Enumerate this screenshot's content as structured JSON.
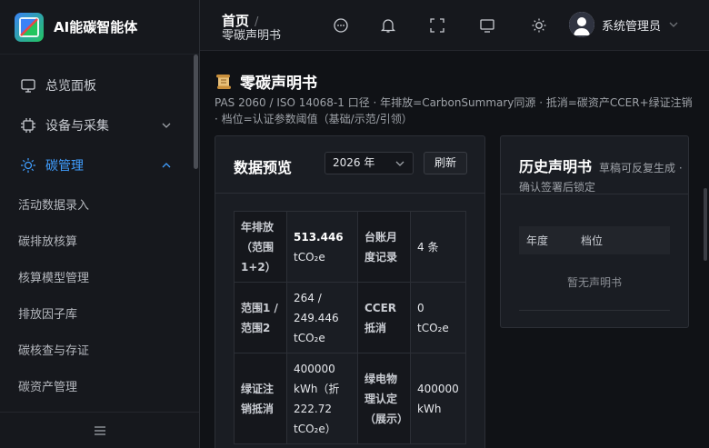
{
  "app": {
    "name": "AI能碳智能体"
  },
  "sidebar": {
    "menu": [
      {
        "label": "总览面板",
        "icon": "monitor-icon"
      },
      {
        "label": "设备与采集",
        "icon": "chip-icon"
      },
      {
        "label": "碳管理",
        "icon": "sun-icon"
      }
    ],
    "submenu": [
      "活动数据录入",
      "碳排放核算",
      "核算模型管理",
      "排放因子库",
      "碳核查与存证",
      "碳资产管理"
    ]
  },
  "header": {
    "breadcrumb_home": "首页",
    "breadcrumb_sep": "/",
    "breadcrumb_current": "零碳声明书",
    "user_name": "系统管理员"
  },
  "page": {
    "title": "零碳声明书",
    "title_icon": "scroll-icon",
    "description": "PAS 2060 / ISO 14068-1 口径 · 年排放=CarbonSummary同源 · 抵消=碳资产CCER+绿证注销 · 档位=认证参数阈值（基础/示范/引领）"
  },
  "preview": {
    "title": "数据预览",
    "year": "2026 年",
    "refresh_label": "刷新",
    "rows": [
      {
        "k1": "年排放（范围1+2）",
        "v1_strong": "513.446",
        "v1": "tCO₂e",
        "k2": "台账月度记录",
        "v2": "4 条"
      },
      {
        "k1": "范围1 / 范围2",
        "v1": "264 / 249.446 tCO₂e",
        "k2": "CCER抵消",
        "v2": "0 tCO₂e"
      },
      {
        "k1": "绿证注销抵消",
        "v1": "400000 kWh（折 222.72 tCO₂e）",
        "k2": "绿电物理认定（展示）",
        "v2": "400000 kWh"
      }
    ]
  },
  "history": {
    "title": "历史声明书",
    "subtitle": "草稿可反复生成 · 确认签署后锁定",
    "col_year": "年度",
    "col_level": "档位",
    "empty_text": "暂无声明书"
  }
}
